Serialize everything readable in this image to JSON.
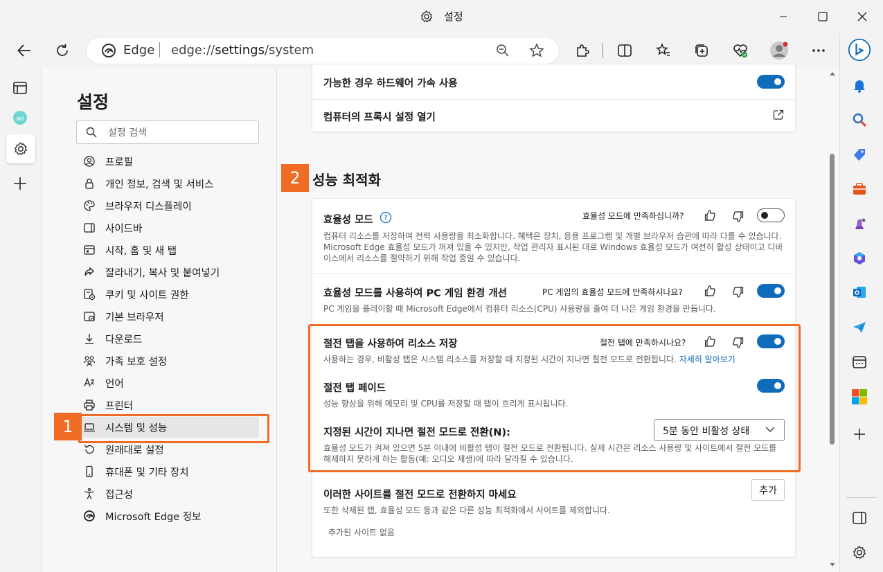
{
  "window": {
    "title": "설정"
  },
  "address": {
    "brand": "Edge",
    "url_prefix": "edge://",
    "url_main": "settings",
    "url_suffix": "/system"
  },
  "settings": {
    "title": "설정",
    "search_placeholder": "설정 검색",
    "nav": [
      {
        "label": "프로필",
        "icon": "profile-icon"
      },
      {
        "label": "개인 정보, 검색 및 서비스",
        "icon": "lock-icon"
      },
      {
        "label": "브라우저 디스플레이",
        "icon": "palette-icon"
      },
      {
        "label": "사이드바",
        "icon": "sidebar-icon"
      },
      {
        "label": "시작, 홈 및 새 탭",
        "icon": "home-icon"
      },
      {
        "label": "잘라내기, 복사 및 붙여넣기",
        "icon": "share-icon"
      },
      {
        "label": "쿠키 및 사이트 권한",
        "icon": "cookie-icon"
      },
      {
        "label": "기본 브라우저",
        "icon": "browser-icon"
      },
      {
        "label": "다운로드",
        "icon": "download-icon"
      },
      {
        "label": "가족 보호 설정",
        "icon": "family-icon"
      },
      {
        "label": "언어",
        "icon": "language-icon"
      },
      {
        "label": "프린터",
        "icon": "printer-icon"
      },
      {
        "label": "시스템 및 성능",
        "icon": "laptop-icon",
        "active": true
      },
      {
        "label": "원래대로 설정",
        "icon": "reset-icon"
      },
      {
        "label": "휴대폰 및 기타 장치",
        "icon": "phone-icon"
      },
      {
        "label": "접근성",
        "icon": "accessibility-icon"
      },
      {
        "label": "Microsoft Edge 정보",
        "icon": "edge-icon"
      }
    ]
  },
  "system_card": {
    "hw_accel": {
      "title": "가능한 경우 하드웨어 가속 사용",
      "enabled": true
    },
    "proxy": {
      "title": "컴퓨터의 프록시 설정 열기"
    }
  },
  "performance": {
    "section_title": "성능 최적화",
    "efficiency": {
      "title": "효율성 모드",
      "feedback": "효율성 모드에 만족하십니까?",
      "desc": "컴퓨터 리소스를 저장하여 전력 사용량을 최소화합니다. 혜택은 장치, 응용 프로그램 및 개별 브라우저 습관에 따라 다를 수 있습니다. Microsoft Edge 효율성 모드가 꺼져 있을 수 있지만, 작업 관리자 표시된 대로 Windows 효율성 모드가 여전히 활성 상태이고 디바이스에서 리소스를 절약하기 위해 작업 중일 수 있습니다.",
      "enabled": false
    },
    "gaming": {
      "title": "효율성 모드를 사용하여 PC 게임 환경 개선",
      "feedback": "PC 게임의 효율성 모드에 만족하시나요?",
      "desc": "PC 게임을 플레이할 때 Microsoft Edge에서 컴퓨터 리소스(CPU) 사용량을 줄여 더 나은 게임 환경을 만듭니다.",
      "enabled": true
    },
    "sleeping_tabs": {
      "title": "절전 탭을 사용하여 리소스 저장",
      "feedback": "절전 탭에 만족하시나요?",
      "desc": "사용하는 경우, 비활성 탭은 시스템 리소스를 저장할 때 지정된 시간이 지나면 절전 모드로 전환됩니다.",
      "link": "자세히 알아보기",
      "enabled": true
    },
    "fade": {
      "title": "절전 탭 페이드",
      "desc": "성능 향상을 위해 메모리 및 CPU를 저장할 때 탭이 흐리게 표시됩니다.",
      "enabled": true
    },
    "timeout": {
      "title": "지정된 시간이 지나면 절전 모드로 전환(N):",
      "selected": "5분 동안 비활성 상태",
      "desc": "효율성 모드가 켜져 있으면 5분 이내에 비활성 탭이 절전 모드로 전환됩니다. 실제 시간은 리소스 사용량 및 사이트에서 절전 모드를 해제하지 못하게 하는 활동(예: 오디오 재생)에 따라 달라질 수 있습니다."
    },
    "never_sleep": {
      "title": "이러한 사이트를 절전 모드로 전환하지 마세요",
      "desc": "또한 삭제된 탭, 효율성 모드 등과 같은 다른 성능 최적화에서 사이트를 제외합니다.",
      "add_label": "추가",
      "empty": "추가된 사이트 없음"
    }
  },
  "annotations": {
    "badge1": "1",
    "badge2": "2"
  },
  "colors": {
    "accent": "#0f6cbd",
    "highlight": "#f06b23"
  }
}
